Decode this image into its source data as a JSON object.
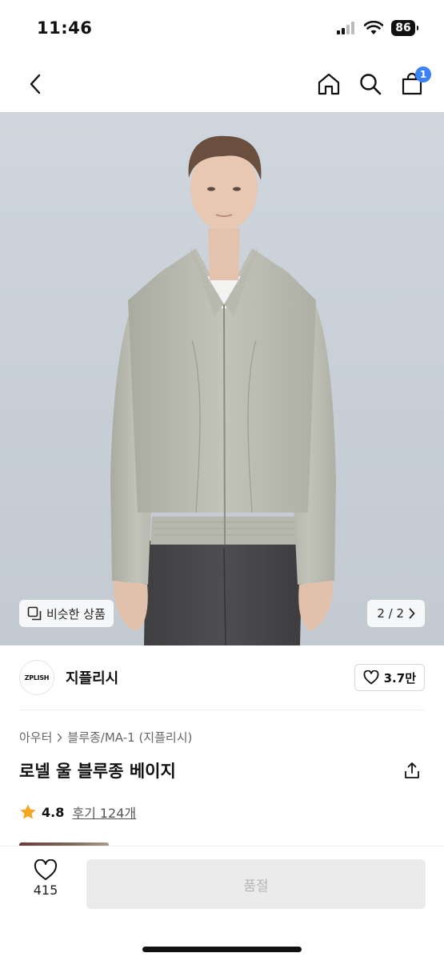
{
  "status_bar": {
    "time": "11:46",
    "battery": "86"
  },
  "nav": {
    "cart_count": "1"
  },
  "hero": {
    "similar_label": "비슷한 상품",
    "page_indicator": "2 / 2"
  },
  "brand": {
    "logo_text": "ZPLISH",
    "name": "지플리시",
    "likes": "3.7만"
  },
  "product": {
    "breadcrumb": [
      "아우터",
      "블루종/MA-1 (지플리시)"
    ],
    "title": "로넬 울 블루종 베이지",
    "rating": "4.8",
    "reviews": "후기 124개"
  },
  "bottom": {
    "wish_count": "415",
    "cta_label": "품절"
  },
  "colors": {
    "accent": "#3b82f6",
    "star": "#f5a623",
    "disabled_bg": "#ebebeb"
  },
  "icons": [
    "back-icon",
    "home-icon",
    "search-icon",
    "cart-icon",
    "similar-icon",
    "chevron-right-icon",
    "heart-icon",
    "share-icon",
    "star-icon"
  ]
}
